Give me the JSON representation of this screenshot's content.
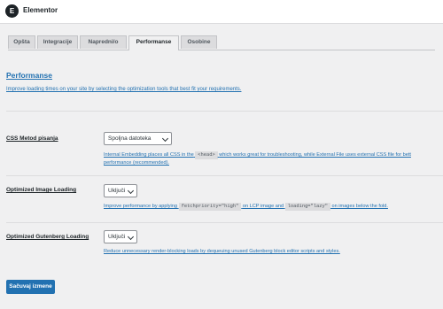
{
  "app": {
    "title": "Elementor",
    "logo_glyph": "E"
  },
  "tabs": [
    {
      "label": "Opšta"
    },
    {
      "label": "Integracije"
    },
    {
      "label": "Napredni/o"
    },
    {
      "label": "Performanse",
      "active": true
    },
    {
      "label": "Osobine"
    }
  ],
  "section": {
    "title": "Performanse",
    "description": "Improve loading times on your site by selecting the optimization tools that best fit your requirements."
  },
  "fields": {
    "css": {
      "label": "CSS Metod pisanja",
      "value": "Spoljna datoteka",
      "help_1": "Internal Embedding places all CSS in the",
      "help_code": "<head>",
      "help_2": "which works great for troubleshooting, while External File uses external CSS file for bett",
      "help_3": "performance (recommended)."
    },
    "image": {
      "label": "Optimized Image Loading",
      "value": "Uključi",
      "help_1": "Improve performance by applying",
      "help_code1": "fetchpriority=\"high\"",
      "help_2": "on LCP image and",
      "help_code2": "loading=\"lazy\"",
      "help_3": "on images below the fold."
    },
    "gutenberg": {
      "label": "Optimized Gutenberg Loading",
      "value": "Uključi",
      "help": "Reduce unnecessary render-blocking loads by dequeuing unused Gutenberg block editor scripts and styles."
    }
  },
  "save_label": "Sačuvaj izmene",
  "colors": {
    "accent": "#2271b1",
    "background": "#f0f0f1"
  }
}
